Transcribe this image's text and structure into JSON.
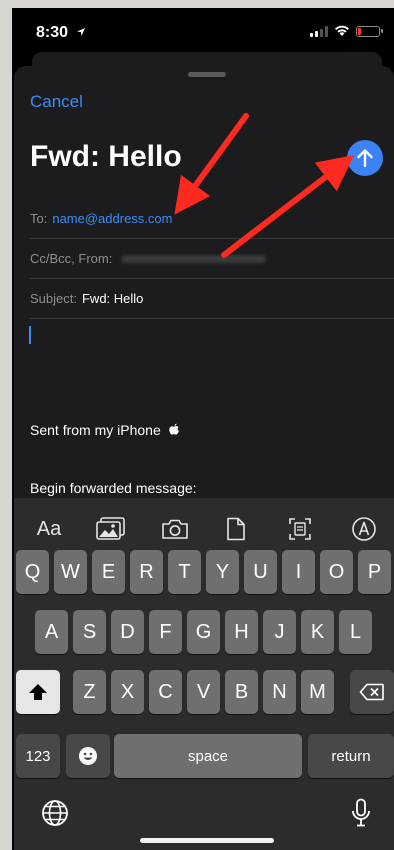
{
  "status_bar": {
    "time": "8:30"
  },
  "compose": {
    "cancel_label": "Cancel",
    "title": "Fwd: Hello",
    "to_label": "To:",
    "to_value": "name@address.com",
    "ccbcc_label": "Cc/Bcc, From:",
    "subject_label": "Subject:",
    "subject_value": "Fwd: Hello",
    "signature": "Sent from my iPhone",
    "forwarded_header": "Begin forwarded message:"
  },
  "keyboard": {
    "format_label": "Aa",
    "row1": [
      "Q",
      "W",
      "E",
      "R",
      "T",
      "Y",
      "U",
      "I",
      "O",
      "P"
    ],
    "row2": [
      "A",
      "S",
      "D",
      "F",
      "G",
      "H",
      "J",
      "K",
      "L"
    ],
    "row3": [
      "Z",
      "X",
      "C",
      "V",
      "B",
      "N",
      "M"
    ],
    "numbers_label": "123",
    "space_label": "space",
    "return_label": "return"
  },
  "annotations": {
    "arrow_color": "#ff2a1f"
  },
  "colors": {
    "accent": "#3b8cf5",
    "send": "#3b82f6"
  }
}
